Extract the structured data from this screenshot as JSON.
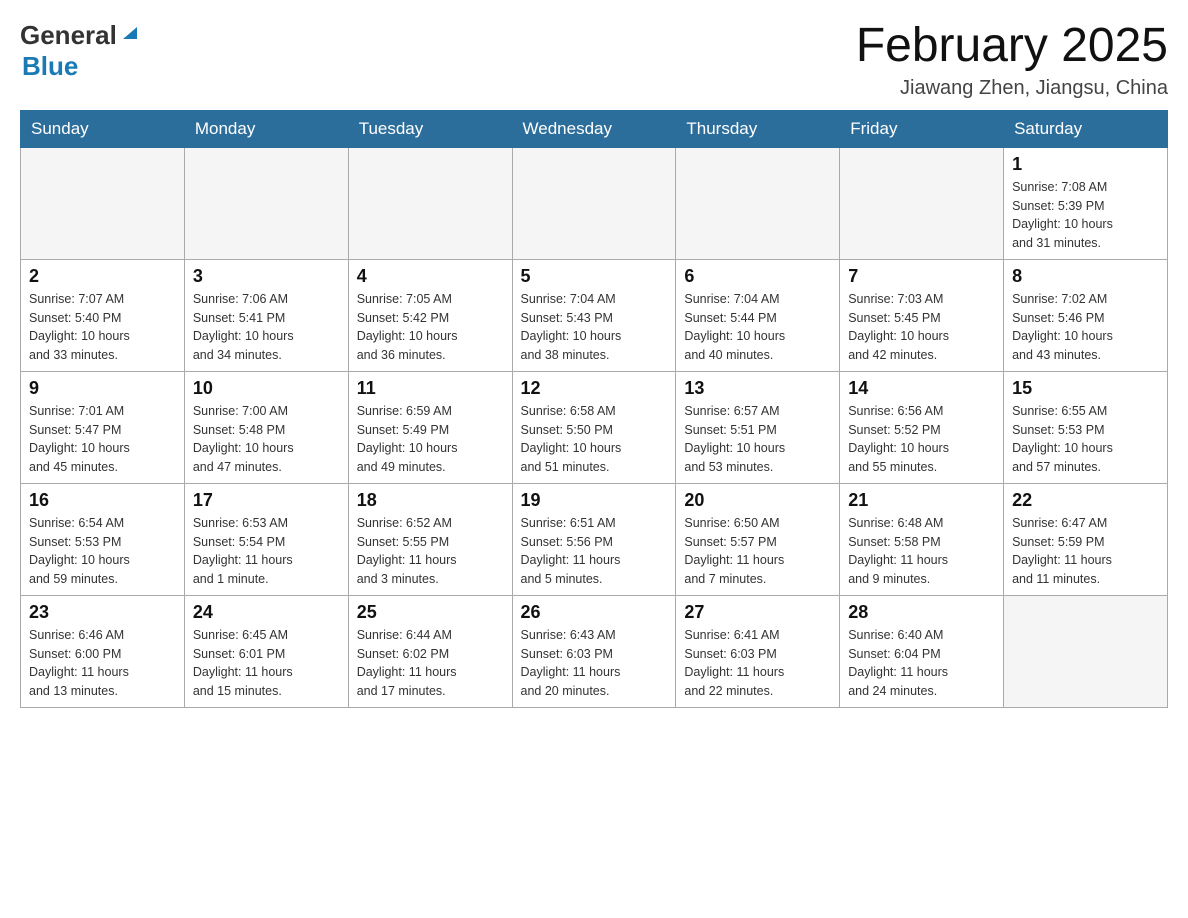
{
  "header": {
    "logo_general": "General",
    "logo_blue": "Blue",
    "month_title": "February 2025",
    "location": "Jiawang Zhen, Jiangsu, China"
  },
  "days_of_week": [
    "Sunday",
    "Monday",
    "Tuesday",
    "Wednesday",
    "Thursday",
    "Friday",
    "Saturday"
  ],
  "weeks": [
    [
      {
        "day": "",
        "info": ""
      },
      {
        "day": "",
        "info": ""
      },
      {
        "day": "",
        "info": ""
      },
      {
        "day": "",
        "info": ""
      },
      {
        "day": "",
        "info": ""
      },
      {
        "day": "",
        "info": ""
      },
      {
        "day": "1",
        "info": "Sunrise: 7:08 AM\nSunset: 5:39 PM\nDaylight: 10 hours\nand 31 minutes."
      }
    ],
    [
      {
        "day": "2",
        "info": "Sunrise: 7:07 AM\nSunset: 5:40 PM\nDaylight: 10 hours\nand 33 minutes."
      },
      {
        "day": "3",
        "info": "Sunrise: 7:06 AM\nSunset: 5:41 PM\nDaylight: 10 hours\nand 34 minutes."
      },
      {
        "day": "4",
        "info": "Sunrise: 7:05 AM\nSunset: 5:42 PM\nDaylight: 10 hours\nand 36 minutes."
      },
      {
        "day": "5",
        "info": "Sunrise: 7:04 AM\nSunset: 5:43 PM\nDaylight: 10 hours\nand 38 minutes."
      },
      {
        "day": "6",
        "info": "Sunrise: 7:04 AM\nSunset: 5:44 PM\nDaylight: 10 hours\nand 40 minutes."
      },
      {
        "day": "7",
        "info": "Sunrise: 7:03 AM\nSunset: 5:45 PM\nDaylight: 10 hours\nand 42 minutes."
      },
      {
        "day": "8",
        "info": "Sunrise: 7:02 AM\nSunset: 5:46 PM\nDaylight: 10 hours\nand 43 minutes."
      }
    ],
    [
      {
        "day": "9",
        "info": "Sunrise: 7:01 AM\nSunset: 5:47 PM\nDaylight: 10 hours\nand 45 minutes."
      },
      {
        "day": "10",
        "info": "Sunrise: 7:00 AM\nSunset: 5:48 PM\nDaylight: 10 hours\nand 47 minutes."
      },
      {
        "day": "11",
        "info": "Sunrise: 6:59 AM\nSunset: 5:49 PM\nDaylight: 10 hours\nand 49 minutes."
      },
      {
        "day": "12",
        "info": "Sunrise: 6:58 AM\nSunset: 5:50 PM\nDaylight: 10 hours\nand 51 minutes."
      },
      {
        "day": "13",
        "info": "Sunrise: 6:57 AM\nSunset: 5:51 PM\nDaylight: 10 hours\nand 53 minutes."
      },
      {
        "day": "14",
        "info": "Sunrise: 6:56 AM\nSunset: 5:52 PM\nDaylight: 10 hours\nand 55 minutes."
      },
      {
        "day": "15",
        "info": "Sunrise: 6:55 AM\nSunset: 5:53 PM\nDaylight: 10 hours\nand 57 minutes."
      }
    ],
    [
      {
        "day": "16",
        "info": "Sunrise: 6:54 AM\nSunset: 5:53 PM\nDaylight: 10 hours\nand 59 minutes."
      },
      {
        "day": "17",
        "info": "Sunrise: 6:53 AM\nSunset: 5:54 PM\nDaylight: 11 hours\nand 1 minute."
      },
      {
        "day": "18",
        "info": "Sunrise: 6:52 AM\nSunset: 5:55 PM\nDaylight: 11 hours\nand 3 minutes."
      },
      {
        "day": "19",
        "info": "Sunrise: 6:51 AM\nSunset: 5:56 PM\nDaylight: 11 hours\nand 5 minutes."
      },
      {
        "day": "20",
        "info": "Sunrise: 6:50 AM\nSunset: 5:57 PM\nDaylight: 11 hours\nand 7 minutes."
      },
      {
        "day": "21",
        "info": "Sunrise: 6:48 AM\nSunset: 5:58 PM\nDaylight: 11 hours\nand 9 minutes."
      },
      {
        "day": "22",
        "info": "Sunrise: 6:47 AM\nSunset: 5:59 PM\nDaylight: 11 hours\nand 11 minutes."
      }
    ],
    [
      {
        "day": "23",
        "info": "Sunrise: 6:46 AM\nSunset: 6:00 PM\nDaylight: 11 hours\nand 13 minutes."
      },
      {
        "day": "24",
        "info": "Sunrise: 6:45 AM\nSunset: 6:01 PM\nDaylight: 11 hours\nand 15 minutes."
      },
      {
        "day": "25",
        "info": "Sunrise: 6:44 AM\nSunset: 6:02 PM\nDaylight: 11 hours\nand 17 minutes."
      },
      {
        "day": "26",
        "info": "Sunrise: 6:43 AM\nSunset: 6:03 PM\nDaylight: 11 hours\nand 20 minutes."
      },
      {
        "day": "27",
        "info": "Sunrise: 6:41 AM\nSunset: 6:03 PM\nDaylight: 11 hours\nand 22 minutes."
      },
      {
        "day": "28",
        "info": "Sunrise: 6:40 AM\nSunset: 6:04 PM\nDaylight: 11 hours\nand 24 minutes."
      },
      {
        "day": "",
        "info": ""
      }
    ]
  ]
}
